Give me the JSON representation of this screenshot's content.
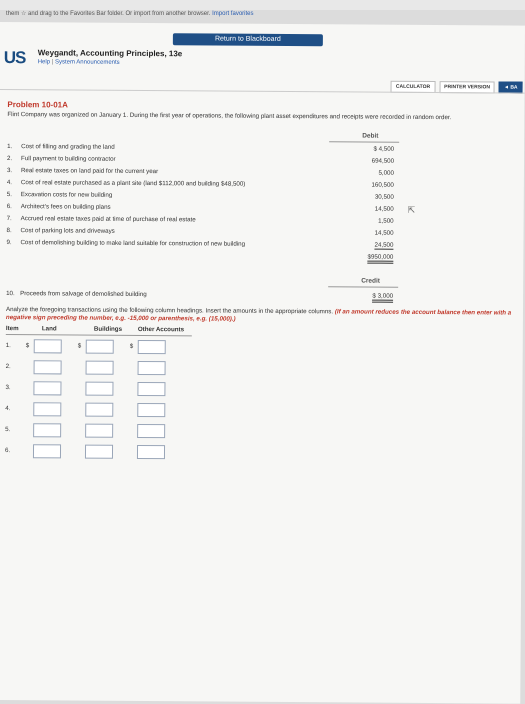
{
  "bookmarks": {
    "text_before": "them ☆ and drag to the Favorites Bar folder. Or import from another browser.",
    "link": "Import favorites"
  },
  "return_button": "Return to Blackboard",
  "logo": "US",
  "book_title": "Weygandt, Accounting Principles, 13e",
  "book_links": {
    "help": "Help",
    "separator": "|",
    "announcements": "System Announcements"
  },
  "tools": {
    "calculator": "CALCULATOR",
    "printer": "PRINTER VERSION",
    "back": "◄ BA"
  },
  "problem": {
    "title": "Problem 10-01A",
    "description": "Flint Company was organized on January 1. During the first year of operations, the following plant asset expenditures and receipts were recorded in random order."
  },
  "debit_header": "Debit",
  "credit_header": "Credit",
  "debits": [
    {
      "num": "1.",
      "text": "Cost of filling and grading the land",
      "amount": "$ 4,500"
    },
    {
      "num": "2.",
      "text": "Full payment to building contractor",
      "amount": "694,500"
    },
    {
      "num": "3.",
      "text": "Real estate taxes on land paid for the current year",
      "amount": "5,000"
    },
    {
      "num": "4.",
      "text": "Cost of real estate purchased as a plant site (land $112,000 and building $48,500)",
      "amount": "160,500"
    },
    {
      "num": "5.",
      "text": "Excavation costs for new building",
      "amount": "30,500"
    },
    {
      "num": "6.",
      "text": "Architect's fees on building plans",
      "amount": "14,500"
    },
    {
      "num": "7.",
      "text": "Accrued real estate taxes paid at time of purchase of real estate",
      "amount": "1,500"
    },
    {
      "num": "8.",
      "text": "Cost of parking lots and driveways",
      "amount": "14,500"
    },
    {
      "num": "9.",
      "text": "Cost of demolishing building to make land suitable for construction of new building",
      "amount": "24,500"
    }
  ],
  "debit_total": "$950,000",
  "credits": [
    {
      "num": "10.",
      "text": "Proceeds from salvage of demolished building",
      "amount": "$ 3,000"
    }
  ],
  "instructions": {
    "normal": "Analyze the foregoing transactions using the following column headings. Insert the amounts in the appropriate columns.",
    "red": "(If an amount reduces the account balance then enter with a negative sign preceding the number, e.g. -15,000 or parenthesis, e.g. (15,000).)"
  },
  "table": {
    "headers": [
      "Item",
      "Land",
      "Buildings",
      "Other Accounts"
    ],
    "currency": "$",
    "rows": [
      "1.",
      "2.",
      "3.",
      "4.",
      "5.",
      "6."
    ]
  }
}
